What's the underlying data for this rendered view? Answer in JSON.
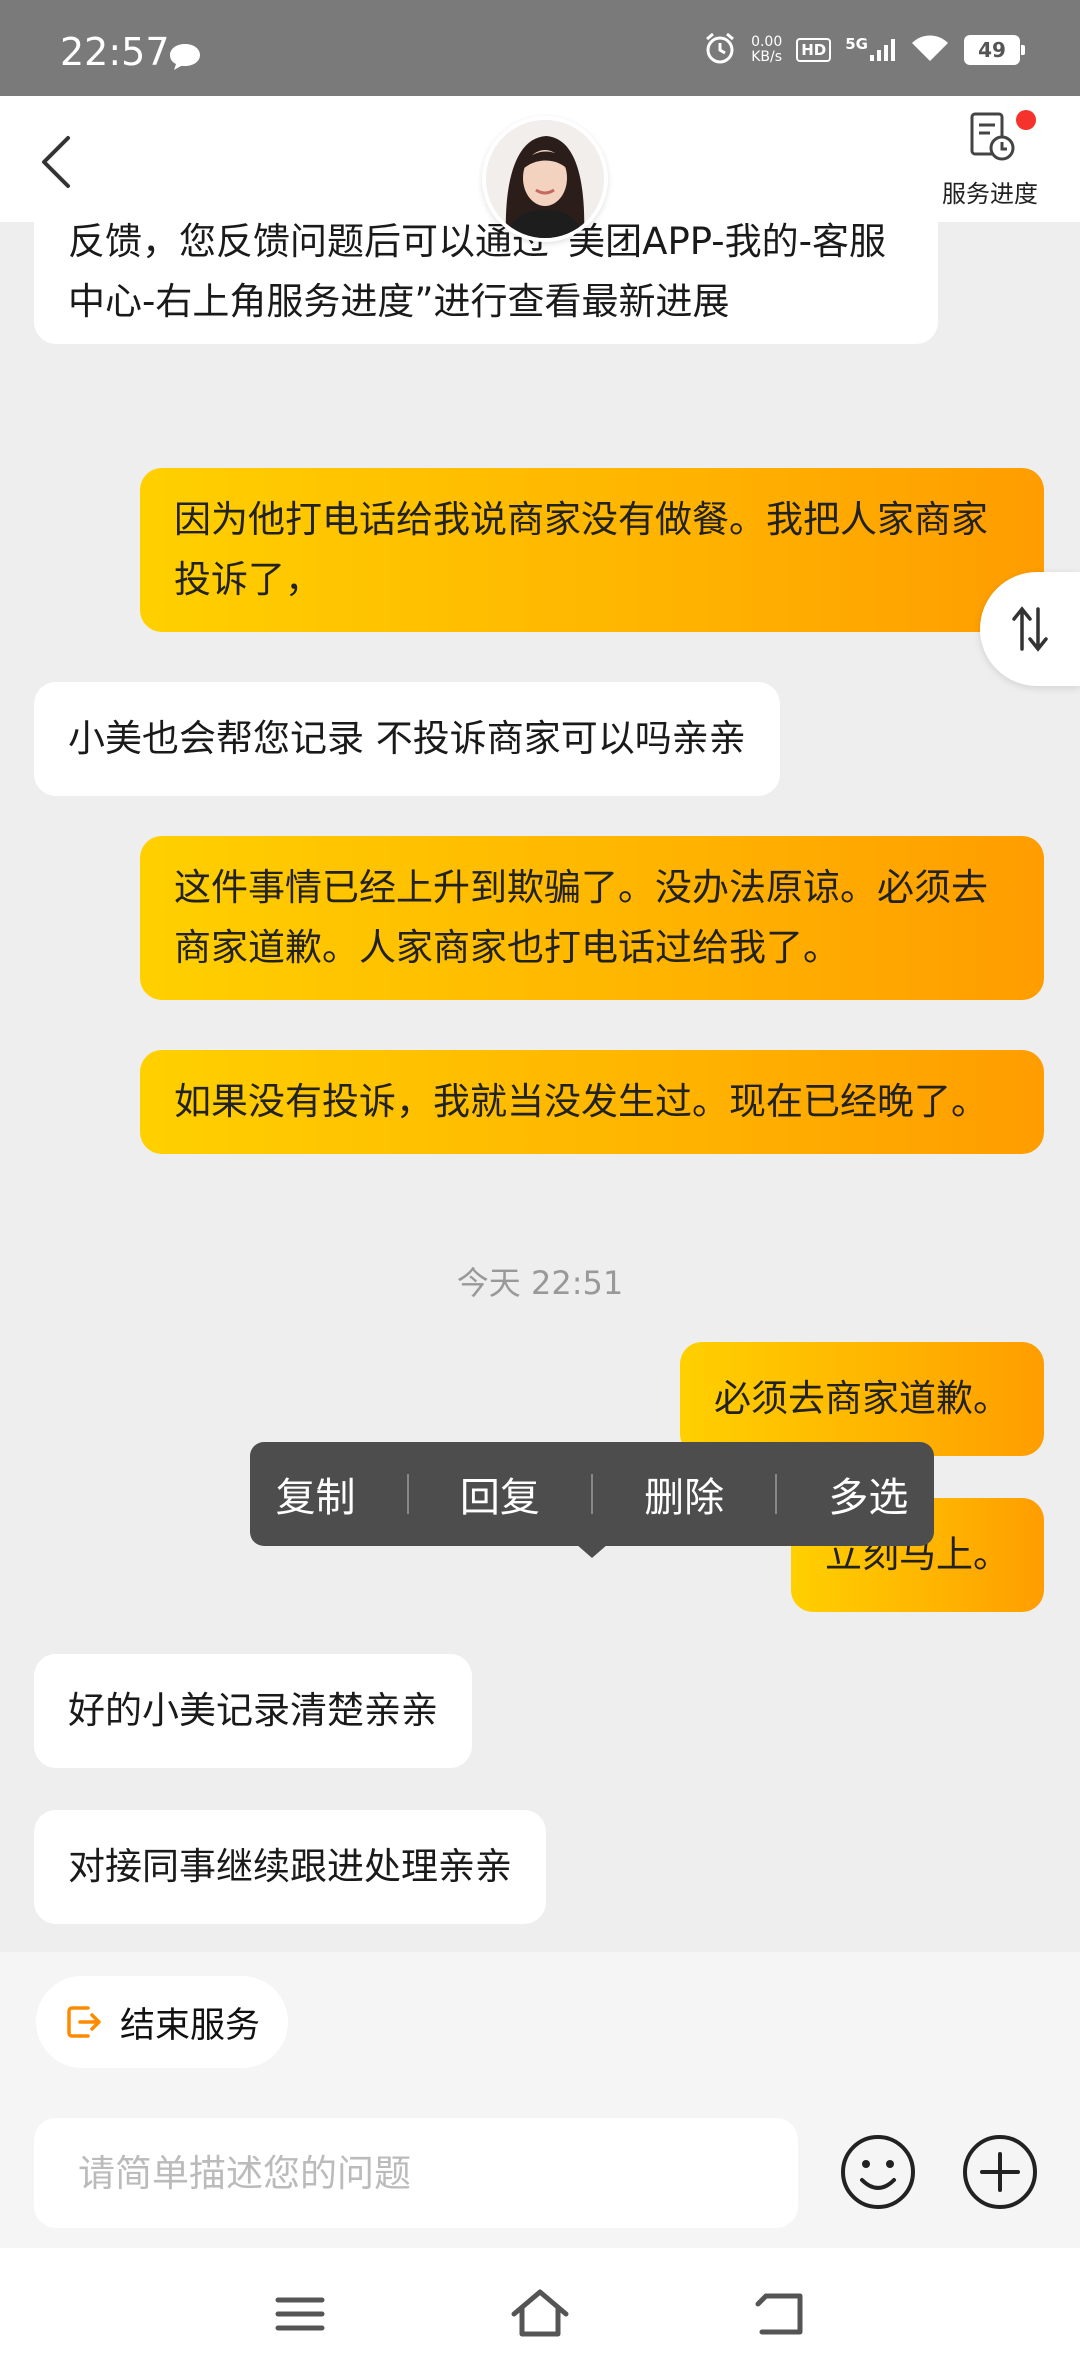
{
  "status_bar": {
    "time": "22:57",
    "net_speed_value": "0.00",
    "net_speed_unit": "KB/s",
    "hd": "HD",
    "network": "5G",
    "battery": "49"
  },
  "header": {
    "service_progress_label": "服务进度"
  },
  "messages": {
    "m1": "反馈，您反馈问题后可以通过“美团APP-我的-客服中心-右上角服务进度”进行查看最新进展",
    "m2": "因为他打电话给我说商家没有做餐。我把人家商家投诉了，",
    "m3": "小美也会帮您记录 不投诉商家可以吗亲亲",
    "m4": "这件事情已经上升到欺骗了。没办法原谅。必须去商家道歉。人家商家也打电话过给我了。",
    "m5": "如果没有投诉，我就当没发生过。现在已经晚了。",
    "m6": "必须去商家道歉。",
    "m7": "立刻马上。",
    "m8": "好的小美记录清楚亲亲",
    "m9": "对接同事继续跟进处理亲亲"
  },
  "timestamp": "今天 22:51",
  "context_menu": {
    "copy": "复制",
    "reply": "回复",
    "delete": "删除",
    "multi_select": "多选"
  },
  "bottom": {
    "end_service_label": "结束服务",
    "input_placeholder": "请简单描述您的问题"
  },
  "colors": {
    "outgoing_bubble_start": "#ffd000",
    "outgoing_bubble_end": "#ff9d00",
    "accent_orange": "#ff8a00",
    "notification_dot": "#f5322b"
  }
}
